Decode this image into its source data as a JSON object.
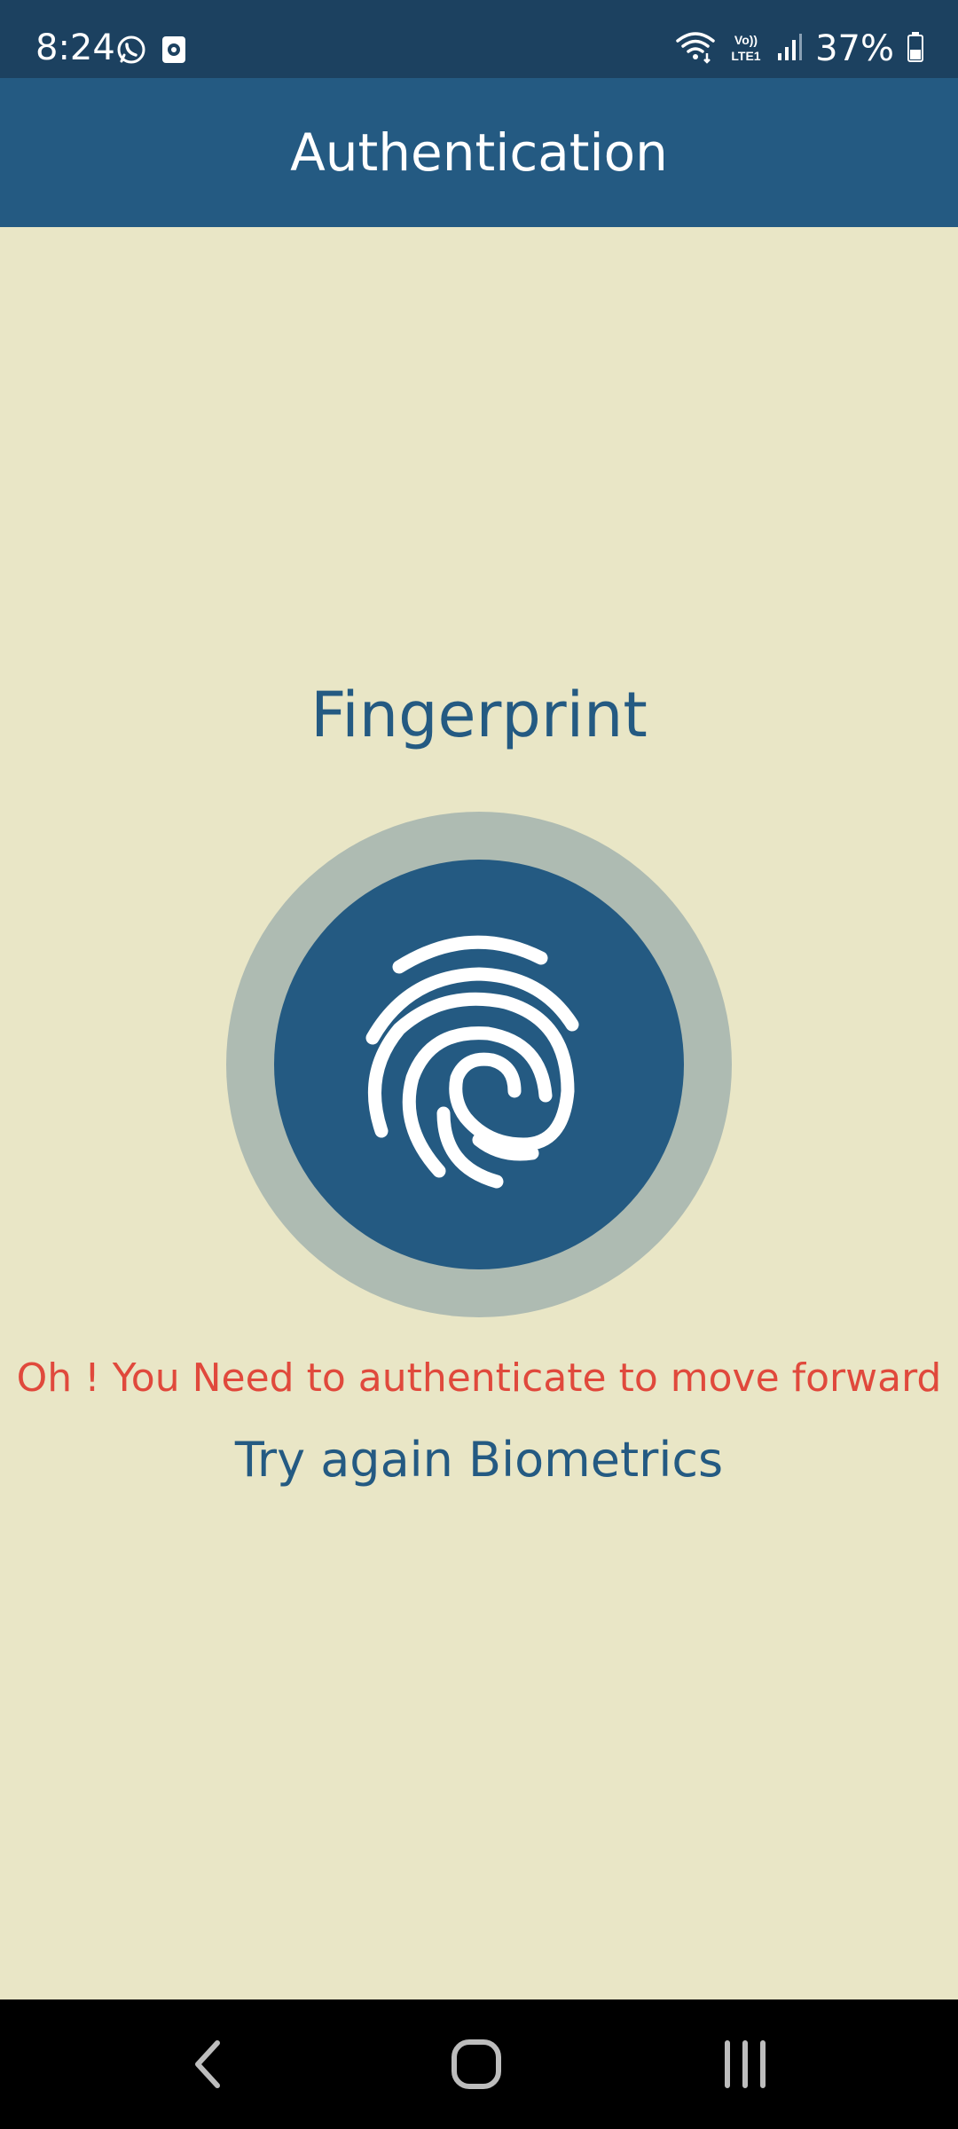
{
  "status_bar": {
    "time": "8:24",
    "battery": "37%",
    "left_icons": [
      "whatsapp-icon",
      "notification-icon"
    ],
    "right_icons": [
      "wifi-icon",
      "volte-icon",
      "signal-icon",
      "battery-icon"
    ],
    "volte_label": "Vo))",
    "lte_label": "LTE1"
  },
  "app_bar": {
    "title": "Authentication"
  },
  "main": {
    "heading": "Fingerprint",
    "error_message": "Oh ! You Need to authenticate to move forward",
    "retry_label": "Try again Biometrics"
  },
  "colors": {
    "status_bar": "#1c4160",
    "app_bar": "#245a82",
    "background": "#e9e6c6",
    "accent": "#245a82",
    "error": "#e0493c",
    "ring": "#aebbb2"
  },
  "nav_bar": {
    "buttons": [
      "back-icon",
      "home-icon",
      "recents-icon"
    ]
  }
}
